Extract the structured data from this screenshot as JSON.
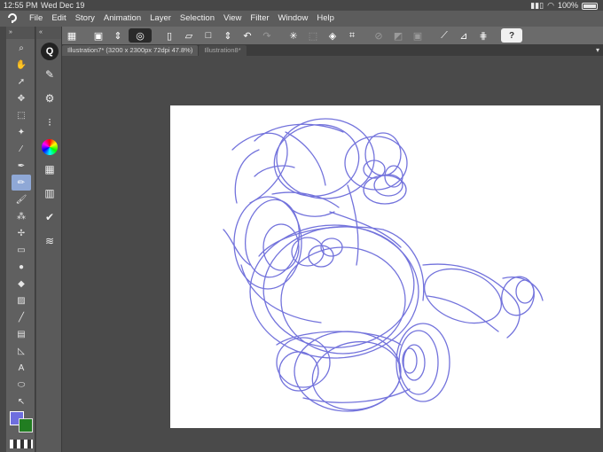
{
  "status": {
    "time": "12:55 PM",
    "date": "Wed Dec 19",
    "battery": "100%"
  },
  "menubar": {
    "items": [
      "File",
      "Edit",
      "Story",
      "Animation",
      "Layer",
      "Selection",
      "View",
      "Filter",
      "Window",
      "Help"
    ]
  },
  "tabs": [
    {
      "label": "Illustration7* (3200 x 2300px 72dpi 47.8%)",
      "active": true
    },
    {
      "label": "Illustration8*",
      "active": false
    }
  ],
  "left_tools_header": "»",
  "sub_tools_header": "«",
  "quick_access_label": "Q",
  "colors": {
    "main": "#6e6ede",
    "sub": "#217d21",
    "sketch_stroke": "#5b5bd6",
    "canvas": "#ffffff"
  },
  "toolbar": {
    "help_label": "?"
  },
  "text_tool_glyph": "A"
}
